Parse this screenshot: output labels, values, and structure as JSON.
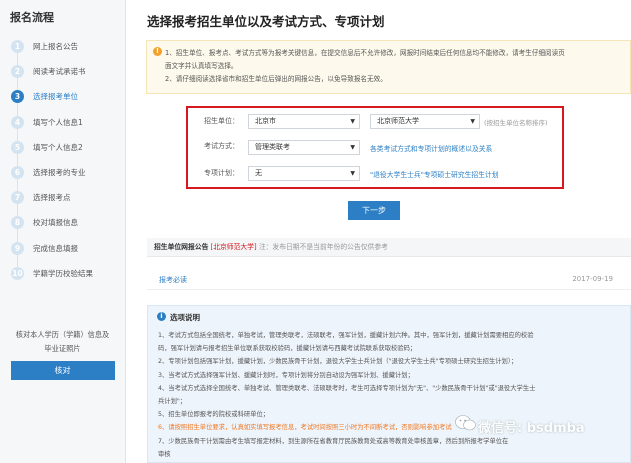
{
  "sidebar": {
    "title": "报名流程",
    "steps": [
      {
        "num": "1",
        "label": "网上报名公告"
      },
      {
        "num": "2",
        "label": "阅读考试承诺书"
      },
      {
        "num": "3",
        "label": "选择报考单位"
      },
      {
        "num": "4",
        "label": "填写个人信息1"
      },
      {
        "num": "5",
        "label": "填写个人信息2"
      },
      {
        "num": "6",
        "label": "选择报考的专业"
      },
      {
        "num": "7",
        "label": "选择报考点"
      },
      {
        "num": "8",
        "label": "校对填报信息"
      },
      {
        "num": "9",
        "label": "完成信息填报"
      },
      {
        "num": "10",
        "label": "学籍学历校验结果"
      }
    ],
    "active_step": 3,
    "verify_text_1": "核对本人学历（学籍）信息及",
    "verify_text_2": "毕业证照片",
    "verify_button": "核对"
  },
  "main": {
    "title": "选择报考招生单位以及考试方式、专项计划",
    "notice": {
      "line1": "1、招生单位、报考点、考试方式等为报考关键信息，在提交信息后不允许修改，网报时间结束后任何信息均不能修改，请考生仔细阅读页",
      "line2": "面文字并认真填写选择。",
      "line3": "2、请仔细阅读选择省市和招生单位后弹出的网报公告，以免导致报名无效。"
    },
    "form": {
      "unit_label": "招生单位：",
      "province_value": "北京市",
      "unit_value": "北京师范大学",
      "unit_hint": "(按招生单位名称排序)",
      "method_label": "考试方式：",
      "method_value": "管理类联考",
      "method_link": "各类考试方式和专项计划的概述以及关系",
      "plan_label": "专项计划：",
      "plan_value": "无",
      "plan_link": "\"退役大学生士兵\"专项硕士研究生招生计划"
    },
    "next_button": "下一步",
    "publication": {
      "title": "招生单位网报公告",
      "unit_tag": "[北京师范大学]",
      "note": "注：发布日期不是当前年份的公告仅供参考",
      "link": "报考必读",
      "date": "2017-09-19"
    },
    "options": {
      "title": "选项说明",
      "lines": [
        "1、考试方式包括全国统考，单独考试，管理类联考，法硕联考，强军计划，援藏计划六种。其中，强军计划，援藏计划需要相应的校验",
        "码，强军计划请与报考招生单位联系获取校验码，援藏计划请与西藏考试院联系获取校验码；",
        "2、专项计划包括强军计划，援藏计划，少数民族骨干计划，退役大学生士兵计划（\"退役大学生士兵\"专项硕士研究生招生计划）；",
        "3、当考试方式选择强军计划、援藏计划时，专项计划将分别自动设为强军计划、援藏计划；",
        "4、当考试方式选择全国统考、单独考试、管理类联考、法硕联考时，考生可选择专项计划为\"无\"、\"少数民族骨干计划\"或\"退役大学生士",
        "兵计划\"；",
        "5、招生单位即报考的院校或科研单位；",
        "6、请按照招生单位要求，认真如实填写报考信息，考试时间按照三小时为不间断考试，否则影响参加考试",
        "7、少数民族骨干计划需由考生填写报定材料，到生源所在省教育厅民族教育处或高等教育处审核盖章，然后到所报考学单位在",
        "审核"
      ]
    },
    "watermark": "微信号: bsdmba"
  },
  "colors": {
    "accent": "#2c7fc4",
    "highlight_border": "#d6191e",
    "notice_bg": "#fdf9ec",
    "option_bg": "#eef4fb"
  }
}
